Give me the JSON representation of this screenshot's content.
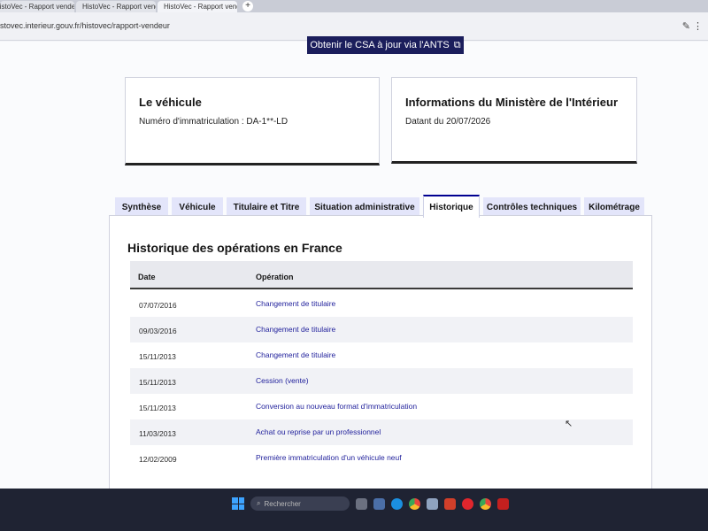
{
  "browser": {
    "tabs": [
      {
        "label": "HistoVec - Rapport vende",
        "active": false
      },
      {
        "label": "HistoVec - Rapport vende",
        "active": false
      },
      {
        "label": "HistoVec - Rapport vende",
        "active": true
      }
    ],
    "new_tab_label": "+",
    "url": "stovec.interieur.gouv.fr/histovec/rapport-vendeur"
  },
  "page": {
    "csa_button": "Obtenir le CSA à jour via l'ANTS",
    "vehicle_card": {
      "title": "Le véhicule",
      "text": "Numéro d'immatriculation : DA-1**-LD"
    },
    "ministry_card": {
      "title": "Informations du Ministère de l'Intérieur",
      "text": "Datant du 20/07/2026"
    },
    "tabs": [
      "Synthèse",
      "Véhicule",
      "Titulaire et Titre",
      "Situation administrative",
      "Historique",
      "Contrôles techniques",
      "Kilométrage"
    ],
    "active_tab_index": 4,
    "history": {
      "title": "Historique des opérations en France",
      "columns": {
        "date": "Date",
        "operation": "Opération"
      },
      "rows": [
        {
          "date": "07/07/2016",
          "operation": "Changement de titulaire"
        },
        {
          "date": "09/03/2016",
          "operation": "Changement de titulaire"
        },
        {
          "date": "15/11/2013",
          "operation": "Changement de titulaire"
        },
        {
          "date": "15/11/2013",
          "operation": "Cession (vente)"
        },
        {
          "date": "15/11/2013",
          "operation": "Conversion au nouveau format d'immatriculation"
        },
        {
          "date": "11/03/2013",
          "operation": "Achat ou reprise par un professionnel"
        },
        {
          "date": "12/02/2009",
          "operation": "Première immatriculation d'un véhicule neuf"
        }
      ]
    }
  },
  "taskbar": {
    "search_placeholder": "Rechercher"
  },
  "colors": {
    "primary": "#000091",
    "dark_button": "#1b1e5c",
    "tab_background": "#e3e5fa",
    "taskbar": "#1f2333"
  }
}
